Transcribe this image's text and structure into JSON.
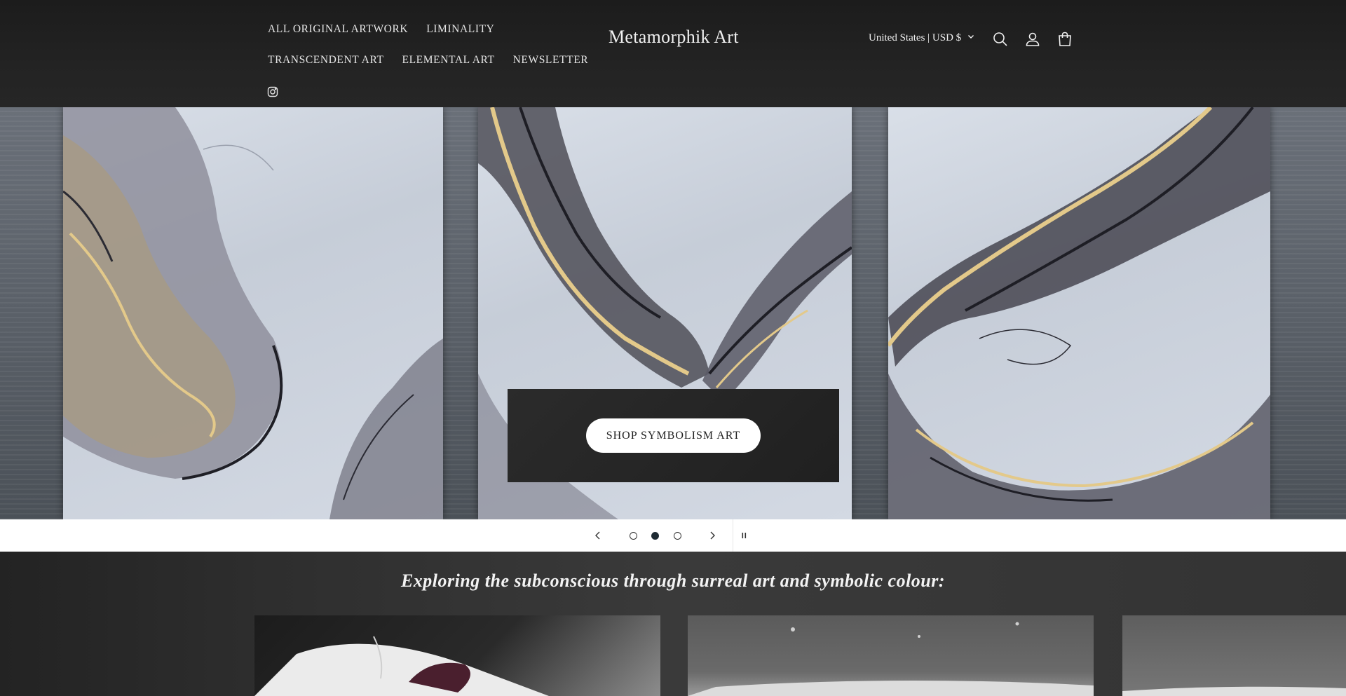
{
  "header": {
    "nav_row1": [
      "ALL ORIGINAL ARTWORK",
      "LIMINALITY"
    ],
    "nav_row2": [
      "TRANSCENDENT ART",
      "ELEMENTAL ART",
      "NEWSLETTER"
    ],
    "logo": "Metamorphik Art",
    "locale": "United States | USD $",
    "icons": [
      "instagram-icon",
      "search-icon",
      "account-icon",
      "cart-icon",
      "chevron-down-icon"
    ]
  },
  "hero": {
    "cta_label": "SHOP SYMBOLISM ART"
  },
  "slider": {
    "total_slides": 3,
    "active_slide": 2,
    "icons": [
      "chevron-left-icon",
      "chevron-right-icon",
      "pause-icon"
    ]
  },
  "section": {
    "tagline": "Exploring the subconscious through surreal art and symbolic colour:"
  },
  "colors": {
    "header_bg": "#1c1c1c",
    "section_bg": "#333333",
    "active_dot": "#1e2a33",
    "button_bg": "#ffffff"
  }
}
